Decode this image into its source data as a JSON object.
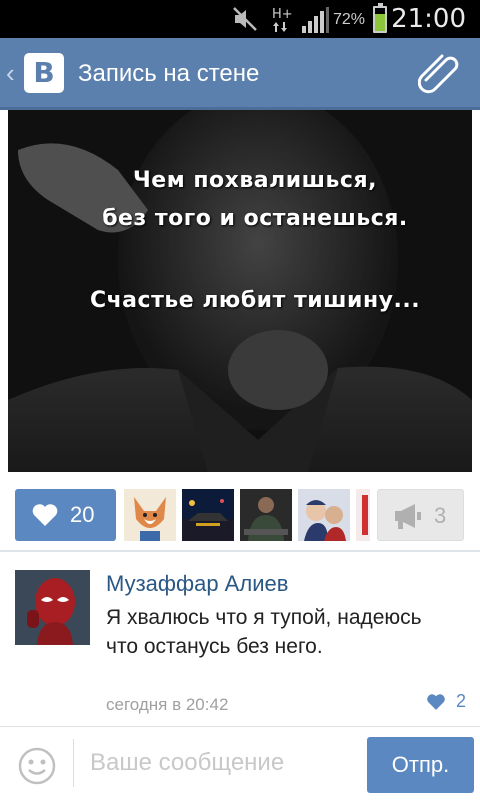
{
  "status_bar": {
    "battery_percent": "72%",
    "time": "21:00",
    "network_label": "H+",
    "icons": [
      "mute-icon",
      "network-h-plus-icon",
      "signal-icon",
      "battery-icon"
    ],
    "battery_level": 0.72
  },
  "header": {
    "logo_letter": "B",
    "title": "Запись на стене",
    "icons": [
      "back-chevron-icon",
      "vk-logo-icon",
      "paperclip-icon"
    ]
  },
  "post": {
    "image": "black-and-white portrait with quote",
    "quote_line1": "Чем похвалишься,",
    "quote_line2": "без того и останешься.",
    "quote_line3": "Счастье любит тишину..."
  },
  "actions": {
    "like_count": "20",
    "repost_count": "3",
    "likers": [
      "fox-avatar",
      "car-avatar",
      "man-avatar",
      "child-avatar",
      "partial-avatar"
    ]
  },
  "comment": {
    "author": "Музаффар Алиев",
    "text": "Я хвалюсь что я тупой, надеюсь что останусь без него.",
    "timestamp": "сегодня в 20:42",
    "like_count": "2"
  },
  "composer": {
    "placeholder": "Ваше сообщение",
    "send_label": "Отпр."
  },
  "colors": {
    "accent": "#5b88c0",
    "header": "#5b80ad",
    "link": "#2a5885"
  }
}
